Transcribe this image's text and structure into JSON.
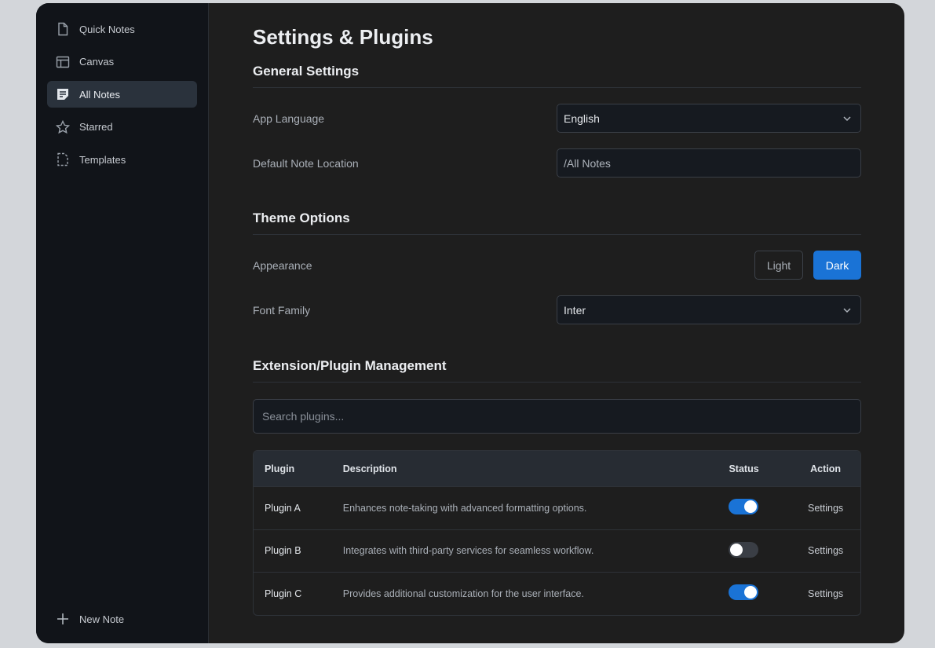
{
  "sidebar": {
    "items": [
      {
        "label": "Quick Notes",
        "icon": "file-icon",
        "active": false
      },
      {
        "label": "Canvas",
        "icon": "layout-icon",
        "active": false
      },
      {
        "label": "All Notes",
        "icon": "notes-icon",
        "active": true
      },
      {
        "label": "Starred",
        "icon": "star-icon",
        "active": false
      },
      {
        "label": "Templates",
        "icon": "template-icon",
        "active": false
      }
    ],
    "new_note_label": "New Note"
  },
  "page": {
    "title": "Settings & Plugins"
  },
  "general": {
    "title": "General Settings",
    "language_label": "App Language",
    "language_value": "English",
    "location_label": "Default Note Location",
    "location_value": "/All Notes"
  },
  "theme": {
    "title": "Theme Options",
    "appearance_label": "Appearance",
    "light_label": "Light",
    "dark_label": "Dark",
    "selected": "Dark",
    "font_label": "Font Family",
    "font_value": "Inter"
  },
  "plugins": {
    "title": "Extension/Plugin Management",
    "search_placeholder": "Search plugins...",
    "columns": {
      "plugin": "Plugin",
      "description": "Description",
      "status": "Status",
      "action": "Action"
    },
    "rows": [
      {
        "name": "Plugin A",
        "description": "Enhances note-taking with advanced formatting options.",
        "enabled": true,
        "action": "Settings"
      },
      {
        "name": "Plugin B",
        "description": "Integrates with third-party services for seamless workflow.",
        "enabled": false,
        "action": "Settings"
      },
      {
        "name": "Plugin C",
        "description": "Provides additional customization for the user interface.",
        "enabled": true,
        "action": "Settings"
      }
    ]
  },
  "colors": {
    "accent": "#1a73d6",
    "window_bg": "#1e1e1e",
    "sidebar_bg": "#111419"
  }
}
